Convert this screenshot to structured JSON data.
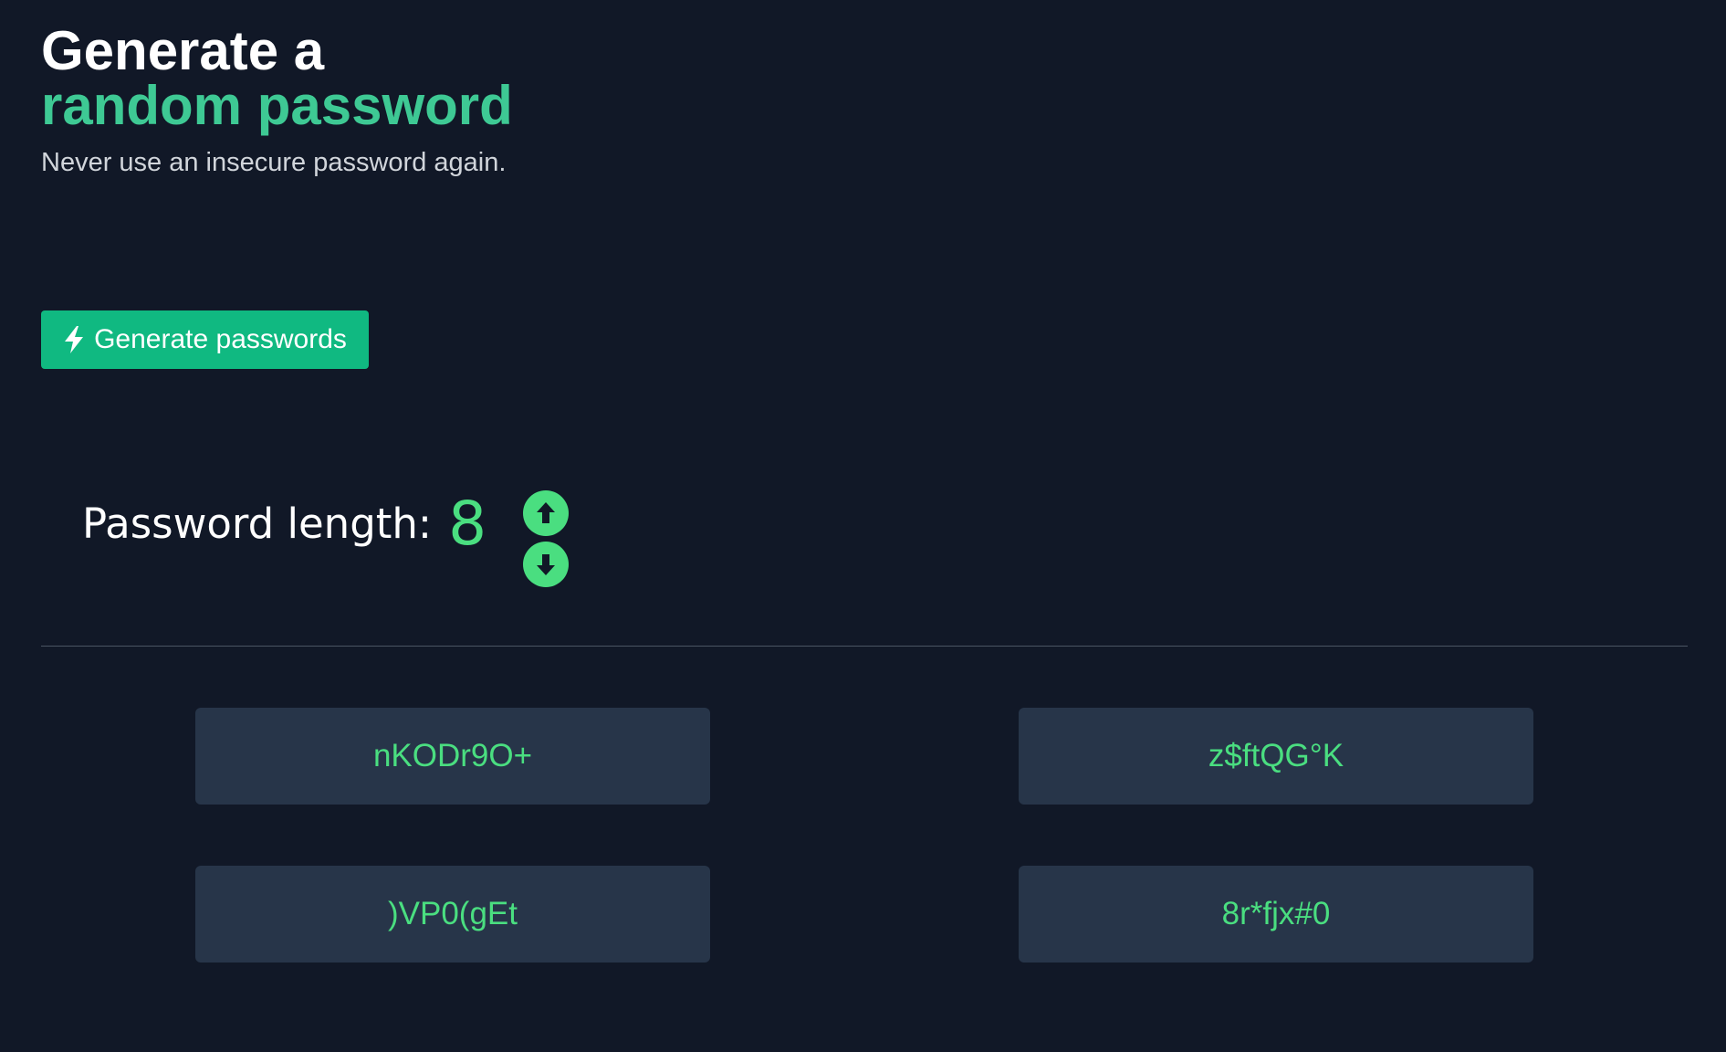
{
  "header": {
    "title_line1": "Generate a",
    "title_line2": "random password",
    "subtitle": "Never use an insecure password again."
  },
  "actions": {
    "generate_label": "Generate passwords",
    "generate_icon": "bolt-icon"
  },
  "length": {
    "label": "Password length:",
    "value": "8",
    "increase_icon": "arrow-up-circle-icon",
    "decrease_icon": "arrow-down-circle-icon"
  },
  "passwords": [
    "nKODr9O+",
    "z$ftQG°K",
    ")VP0(gEt",
    "8r*fjx#0"
  ],
  "colors": {
    "background": "#111827",
    "accent": "#3ec994",
    "button": "#10b981",
    "password_text": "#4ade80",
    "password_bg": "#273549"
  }
}
